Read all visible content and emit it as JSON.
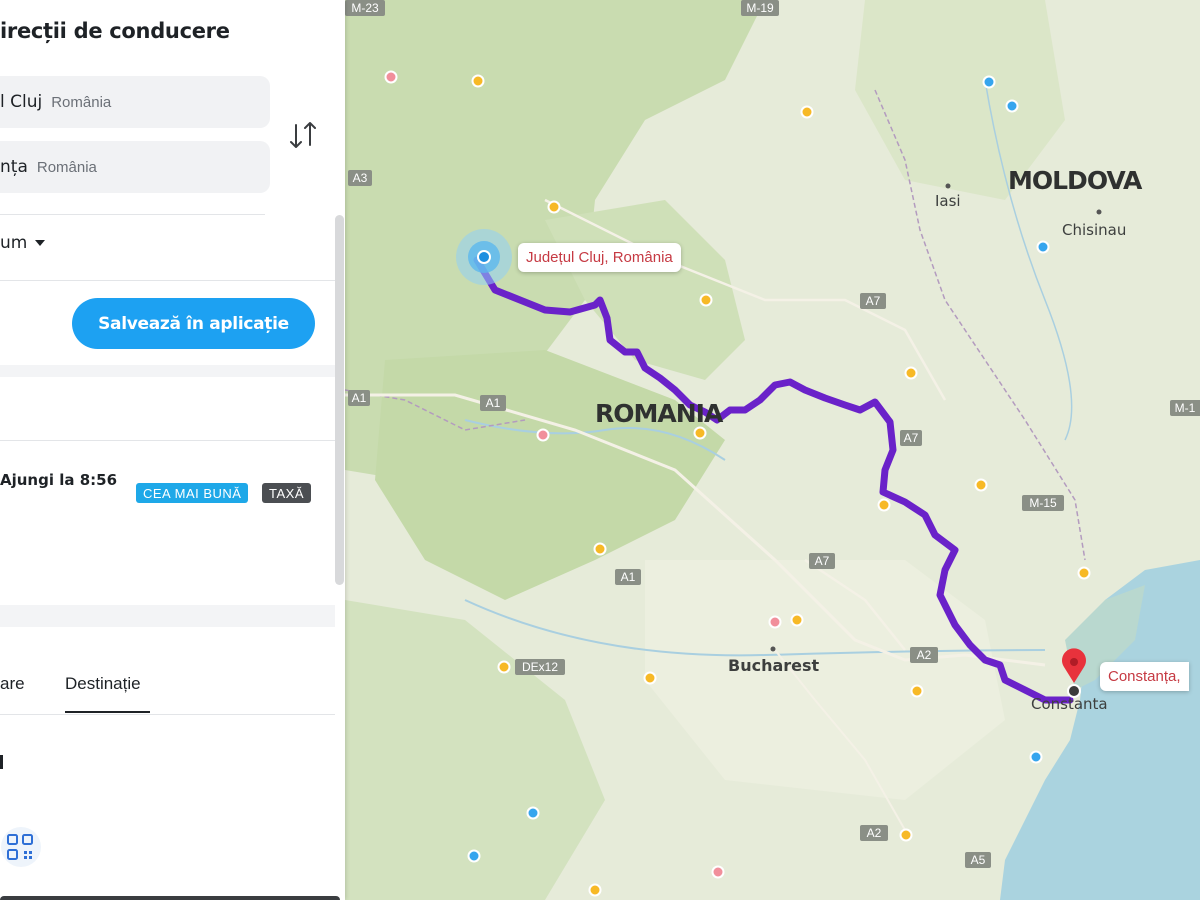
{
  "panel": {
    "title": "irecții de conducere",
    "origin": {
      "main": "l Cluj",
      "sub": "România"
    },
    "destination": {
      "main": "nța",
      "sub": "România"
    },
    "time_selector": "um",
    "save_button": "Salvează în aplicație",
    "route": {
      "arrive": "Ajungi la 8:56",
      "badge_best": "CEA MAI BUNĂ",
      "badge_toll": "TAXĂ"
    },
    "tabs": {
      "left": "are",
      "right": "Destinație"
    },
    "colors": {
      "accent": "#1da1f2",
      "route": "#6a22c9",
      "pin": "#e8323c"
    }
  },
  "map": {
    "countries": {
      "romania": "ROMANIA",
      "moldova": "MOLDOVA"
    },
    "cities": {
      "iasi": "Iasi",
      "chisinau": "Chisinau",
      "bucharest": "Bucharest",
      "constanta": "Constanta"
    },
    "callouts": {
      "origin": "Județul Cluj, România",
      "destination": "Constanța,"
    },
    "shields": {
      "m23": "M-23",
      "m19": "M-19",
      "a3": "A3",
      "a7a": "A7",
      "a7b": "A7",
      "a7c": "A7",
      "a1a": "A1",
      "a1b": "A1",
      "a1c": "A1",
      "m15": "M-15",
      "dex12": "DEx12",
      "a2a": "A2",
      "a2b": "A2",
      "a5": "A5",
      "m1": "M-1"
    }
  }
}
